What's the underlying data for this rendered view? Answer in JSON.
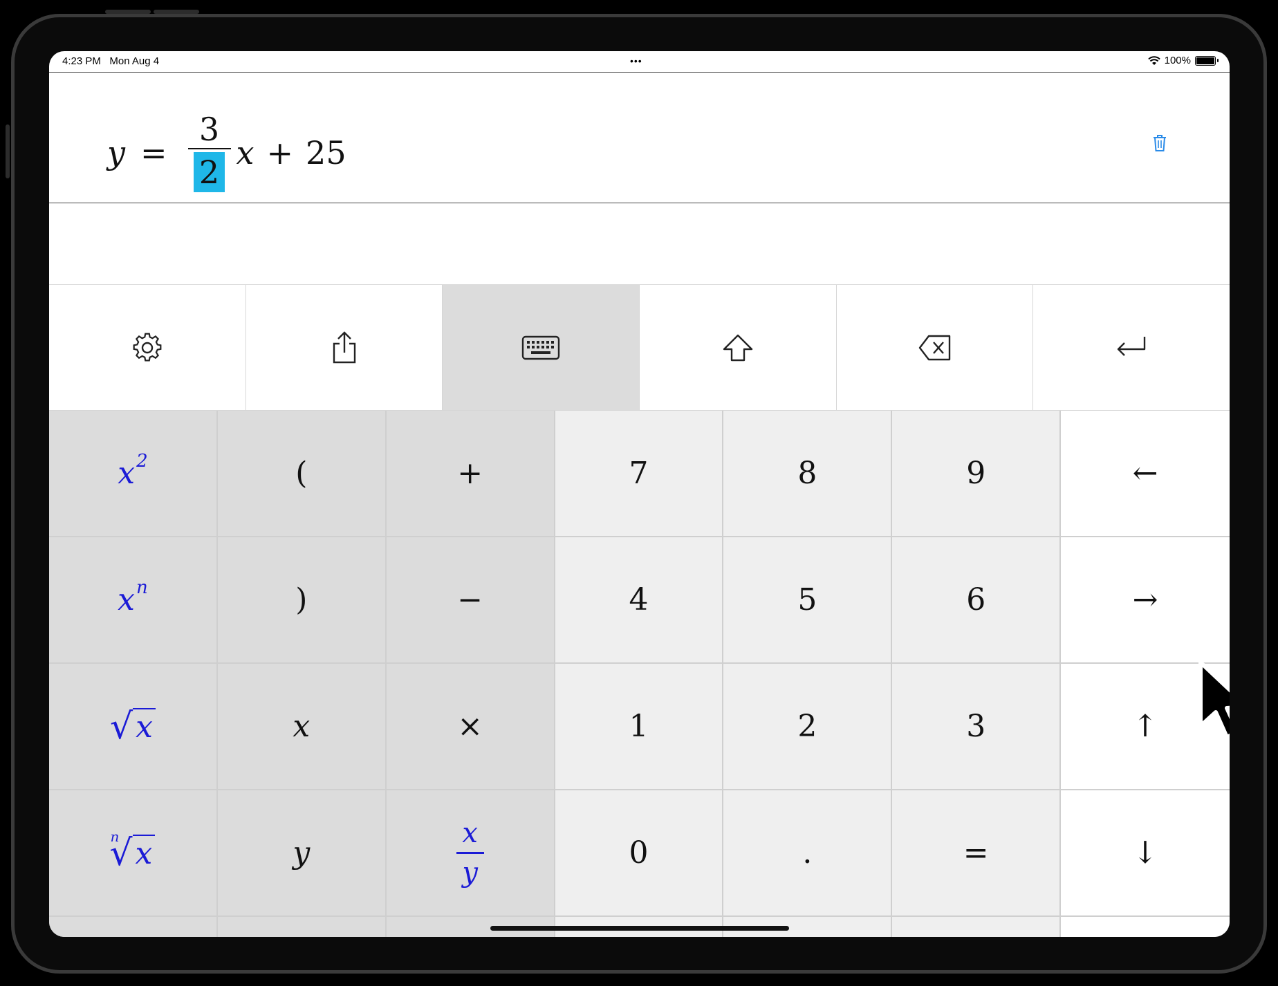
{
  "status_bar": {
    "time": "4:23 PM",
    "date": "Mon Aug 4",
    "multitask_dots": "•••",
    "battery": "100%",
    "wifi_icon": "wifi-icon",
    "battery_icon": "battery-full-icon"
  },
  "formula": {
    "y": "y",
    "equals": "=",
    "numerator": "3",
    "denominator": "2",
    "x": "x",
    "plus": "+",
    "constant": "25"
  },
  "toolbar": {
    "items": [
      {
        "icon": "gear-icon"
      },
      {
        "icon": "share-icon"
      },
      {
        "icon": "keyboard-icon"
      },
      {
        "icon": "shift-icon"
      },
      {
        "icon": "backspace-icon"
      },
      {
        "icon": "return-icon"
      }
    ]
  },
  "keys": {
    "x_squared_base": "x",
    "x_squared_exp": "2",
    "x_n_base": "x",
    "x_n_exp": "n",
    "sqrt_rad": "x",
    "nroot_index": "n",
    "nroot_rad": "x",
    "open_paren": "(",
    "close_paren": ")",
    "var_x": "x",
    "var_y": "y",
    "plus": "+",
    "minus": "−",
    "times": "×",
    "frac_num": "x",
    "frac_den": "y",
    "seven": "7",
    "eight": "8",
    "nine": "9",
    "four": "4",
    "five": "5",
    "six": "6",
    "one": "1",
    "two": "2",
    "three": "3",
    "zero": "0",
    "dot": ".",
    "equals": "=",
    "left": "←",
    "right": "→",
    "up": "↑",
    "down": "↓"
  },
  "colors": {
    "selection": "#1fb7e8",
    "function_key_text": "#1b1bd6",
    "trash_icon": "#2a8be8"
  }
}
